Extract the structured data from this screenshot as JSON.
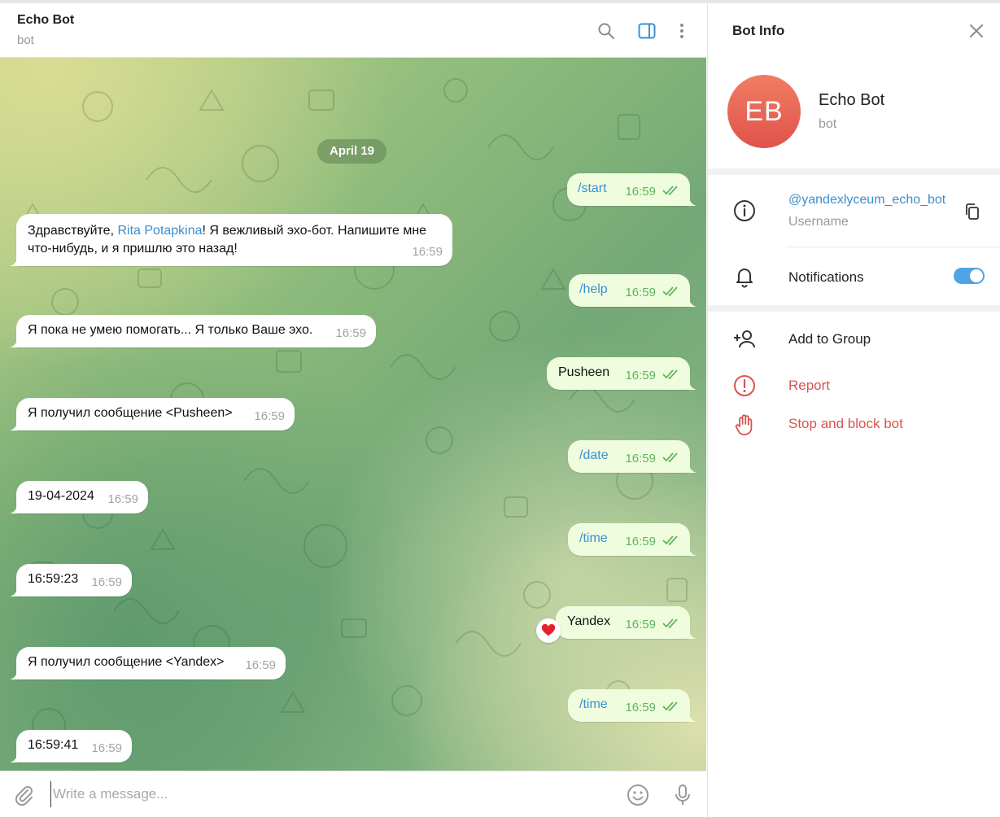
{
  "chat": {
    "title": "Echo Bot",
    "status": "bot",
    "date_pill": "April 19",
    "composer_placeholder": "Write a message...",
    "icons": {
      "search": "search-icon",
      "panel": "sidebar-panel-icon",
      "more": "more-vertical-icon",
      "attach": "paperclip-icon",
      "emoji": "emoji-icon",
      "mic": "microphone-icon"
    },
    "messages": [
      {
        "dir": "out",
        "text": "/start",
        "time": "16:59",
        "cmd": true
      },
      {
        "dir": "in",
        "text_pre": "Здравствуйте, ",
        "mention": "Rita Potapkina",
        "text_line1_rest": "! Я вежливый эхо-бот. Напишите мне",
        "text_line2": "что-нибудь, и я пришлю это назад!",
        "time": "16:59"
      },
      {
        "dir": "out",
        "text": "/help",
        "time": "16:59",
        "cmd": true
      },
      {
        "dir": "in",
        "text": "Я пока не умею помогать... Я только Ваше эхо.",
        "time": "16:59"
      },
      {
        "dir": "out",
        "text": "Pusheen",
        "time": "16:59"
      },
      {
        "dir": "in",
        "text": "Я получил сообщение <Pusheen>",
        "time": "16:59"
      },
      {
        "dir": "out",
        "text": "/date",
        "time": "16:59",
        "cmd": true
      },
      {
        "dir": "in",
        "text": "19-04-2024",
        "time": "16:59"
      },
      {
        "dir": "out",
        "text": "/time",
        "time": "16:59",
        "cmd": true
      },
      {
        "dir": "in",
        "text": "16:59:23",
        "time": "16:59"
      },
      {
        "dir": "out",
        "text": "Yandex",
        "time": "16:59",
        "reaction": "❤️"
      },
      {
        "dir": "in",
        "text": "Я получил сообщение <Yandex>",
        "time": "16:59"
      },
      {
        "dir": "out",
        "text": "/time",
        "time": "16:59",
        "cmd": true
      },
      {
        "dir": "in",
        "text": "16:59:41",
        "time": "16:59"
      }
    ],
    "colors": {
      "outgoing_bubble": "#effdde",
      "incoming_bubble": "#ffffff",
      "link": "#3a8fd1",
      "check": "#5fb45f"
    }
  },
  "info": {
    "title": "Bot Info",
    "avatar_initials": "EB",
    "name": "Echo Bot",
    "subtitle": "bot",
    "username": "@yandexlyceum_echo_bot",
    "username_caption": "Username",
    "notifications_label": "Notifications",
    "notifications_on": true,
    "add_to_group": "Add to Group",
    "report": "Report",
    "stop_block": "Stop and block bot",
    "colors": {
      "avatar": "#e8604f",
      "danger": "#d9534f",
      "toggle": "#4ea4e6"
    }
  }
}
